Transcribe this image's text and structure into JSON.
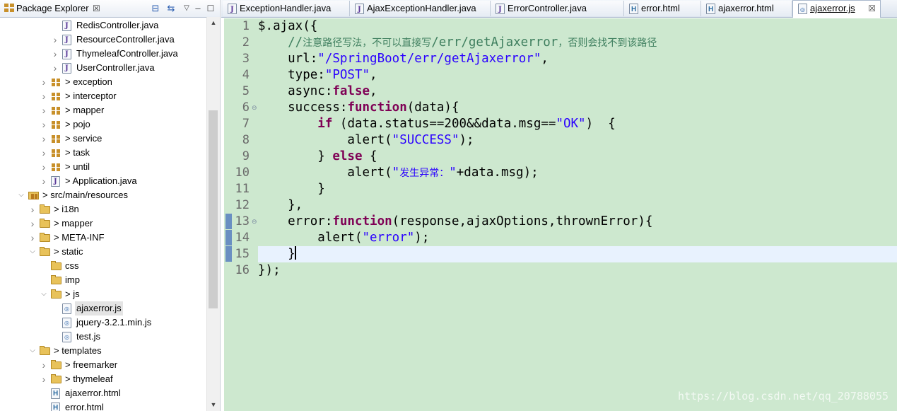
{
  "explorer": {
    "title": "Package Explorer",
    "close": "☒",
    "tree": [
      {
        "label": "RedisController.java",
        "icon": "java-file-icon",
        "depth": 5,
        "twisty": "none"
      },
      {
        "label": "ResourceController.java",
        "icon": "java-file-icon",
        "depth": 5,
        "twisty": "collapsed"
      },
      {
        "label": "ThymeleafController.java",
        "icon": "java-file-icon",
        "depth": 5,
        "twisty": "collapsed"
      },
      {
        "label": "UserController.java",
        "icon": "java-file-icon",
        "depth": 5,
        "twisty": "collapsed"
      },
      {
        "label": "> exception",
        "icon": "package-icon",
        "depth": 4,
        "twisty": "collapsed"
      },
      {
        "label": "> interceptor",
        "icon": "package-icon",
        "depth": 4,
        "twisty": "collapsed"
      },
      {
        "label": "> mapper",
        "icon": "package-icon",
        "depth": 4,
        "twisty": "collapsed"
      },
      {
        "label": "> pojo",
        "icon": "package-icon",
        "depth": 4,
        "twisty": "collapsed"
      },
      {
        "label": "> service",
        "icon": "package-icon",
        "depth": 4,
        "twisty": "collapsed"
      },
      {
        "label": "> task",
        "icon": "package-icon",
        "depth": 4,
        "twisty": "collapsed"
      },
      {
        "label": "> until",
        "icon": "package-icon",
        "depth": 4,
        "twisty": "collapsed"
      },
      {
        "label": "> Application.java",
        "icon": "java-file-icon",
        "depth": 4,
        "twisty": "collapsed"
      },
      {
        "label": "> src/main/resources",
        "icon": "source-folder-icon",
        "depth": 2,
        "twisty": "expanded"
      },
      {
        "label": "> i18n",
        "icon": "folder-icon",
        "depth": 3,
        "twisty": "collapsed"
      },
      {
        "label": "> mapper",
        "icon": "folder-icon",
        "depth": 3,
        "twisty": "collapsed"
      },
      {
        "label": "> META-INF",
        "icon": "folder-icon",
        "depth": 3,
        "twisty": "collapsed"
      },
      {
        "label": "> static",
        "icon": "folder-icon",
        "depth": 3,
        "twisty": "expanded"
      },
      {
        "label": "css",
        "icon": "folder-icon",
        "depth": 4,
        "twisty": "none"
      },
      {
        "label": "imp",
        "icon": "folder-icon",
        "depth": 4,
        "twisty": "none"
      },
      {
        "label": "> js",
        "icon": "folder-icon",
        "depth": 4,
        "twisty": "expanded"
      },
      {
        "label": "ajaxerror.js",
        "icon": "js-file-icon",
        "depth": 5,
        "twisty": "none",
        "selected": true
      },
      {
        "label": "jquery-3.2.1.min.js",
        "icon": "js-file-icon",
        "depth": 5,
        "twisty": "none"
      },
      {
        "label": "test.js",
        "icon": "js-file-icon",
        "depth": 5,
        "twisty": "none"
      },
      {
        "label": "> templates",
        "icon": "folder-icon",
        "depth": 3,
        "twisty": "expanded"
      },
      {
        "label": "> freemarker",
        "icon": "folder-icon",
        "depth": 4,
        "twisty": "collapsed"
      },
      {
        "label": "> thymeleaf",
        "icon": "folder-icon",
        "depth": 4,
        "twisty": "collapsed"
      },
      {
        "label": "ajaxerror.html",
        "icon": "html-file-icon",
        "depth": 4,
        "twisty": "none"
      },
      {
        "label": "error.html",
        "icon": "html-file-icon",
        "depth": 4,
        "twisty": "none"
      }
    ]
  },
  "editor_tabs": [
    {
      "label": "ExceptionHandler.java",
      "icon": "java-file-icon",
      "active": false
    },
    {
      "label": "AjaxExceptionHandler.java",
      "icon": "java-file-icon",
      "active": false
    },
    {
      "label": "ErrorController.java",
      "icon": "java-file-icon",
      "active": false
    },
    {
      "label": "error.html",
      "icon": "html-file-icon",
      "active": false
    },
    {
      "label": "ajaxerror.html",
      "icon": "html-file-icon",
      "active": false
    },
    {
      "label": "ajaxerror.js",
      "icon": "js-file-icon",
      "active": true,
      "close": "☒"
    }
  ],
  "editor": {
    "current_line": 15,
    "lines": [
      {
        "n": "1",
        "fold": "",
        "segments": [
          {
            "t": "$.ajax({",
            "c": ""
          }
        ]
      },
      {
        "n": "2",
        "fold": "",
        "segments": [
          {
            "t": "    //",
            "c": "cmt"
          },
          {
            "t": "注意路径写法，不可以直接写",
            "c": "cmt cn"
          },
          {
            "t": "/err/getAjaxerror",
            "c": "cmt"
          },
          {
            "t": "，否则会找不到该路径",
            "c": "cmt cn"
          }
        ]
      },
      {
        "n": "3",
        "fold": "",
        "segments": [
          {
            "t": "    url:",
            "c": ""
          },
          {
            "t": "\"/SpringBoot/err/getAjaxerror\"",
            "c": "str"
          },
          {
            "t": ",",
            "c": ""
          }
        ]
      },
      {
        "n": "4",
        "fold": "",
        "segments": [
          {
            "t": "    type:",
            "c": ""
          },
          {
            "t": "\"POST\"",
            "c": "str"
          },
          {
            "t": ",",
            "c": ""
          }
        ]
      },
      {
        "n": "5",
        "fold": "",
        "segments": [
          {
            "t": "    async:",
            "c": ""
          },
          {
            "t": "false",
            "c": "kw"
          },
          {
            "t": ",",
            "c": ""
          }
        ]
      },
      {
        "n": "6",
        "fold": "⊖",
        "segments": [
          {
            "t": "    success:",
            "c": ""
          },
          {
            "t": "function",
            "c": "kw"
          },
          {
            "t": "(data){",
            "c": ""
          }
        ]
      },
      {
        "n": "7",
        "fold": "",
        "segments": [
          {
            "t": "        ",
            "c": ""
          },
          {
            "t": "if",
            "c": "kw"
          },
          {
            "t": " (data.status==200&&data.msg==",
            "c": ""
          },
          {
            "t": "\"OK\"",
            "c": "str"
          },
          {
            "t": ")  {",
            "c": ""
          }
        ]
      },
      {
        "n": "8",
        "fold": "",
        "segments": [
          {
            "t": "            alert(",
            "c": ""
          },
          {
            "t": "\"SUCCESS\"",
            "c": "str"
          },
          {
            "t": ");",
            "c": ""
          }
        ]
      },
      {
        "n": "9",
        "fold": "",
        "segments": [
          {
            "t": "        } ",
            "c": ""
          },
          {
            "t": "else",
            "c": "kw"
          },
          {
            "t": " {",
            "c": ""
          }
        ]
      },
      {
        "n": "10",
        "fold": "",
        "segments": [
          {
            "t": "            alert(",
            "c": ""
          },
          {
            "t": "\"",
            "c": "str"
          },
          {
            "t": "发生异常：",
            "c": "str cn"
          },
          {
            "t": "\"",
            "c": "str"
          },
          {
            "t": "+data.msg);",
            "c": ""
          }
        ]
      },
      {
        "n": "11",
        "fold": "",
        "segments": [
          {
            "t": "        }",
            "c": ""
          }
        ]
      },
      {
        "n": "12",
        "fold": "",
        "segments": [
          {
            "t": "    },",
            "c": ""
          }
        ]
      },
      {
        "n": "13",
        "fold": "⊖",
        "segments": [
          {
            "t": "    error:",
            "c": ""
          },
          {
            "t": "function",
            "c": "kw"
          },
          {
            "t": "(response,ajaxOptions,thrownError){",
            "c": ""
          }
        ]
      },
      {
        "n": "14",
        "fold": "",
        "segments": [
          {
            "t": "        alert(",
            "c": ""
          },
          {
            "t": "\"error\"",
            "c": "str"
          },
          {
            "t": ");",
            "c": ""
          }
        ]
      },
      {
        "n": "15",
        "fold": "",
        "segments": [
          {
            "t": "    }",
            "c": ""
          }
        ],
        "caret": true
      },
      {
        "n": "16",
        "fold": "",
        "segments": [
          {
            "t": "});",
            "c": ""
          }
        ]
      }
    ],
    "annotation_lines": [
      13,
      14,
      15
    ]
  },
  "watermark": "https://blog.csdn.net/qq_20788055",
  "colors": {
    "editor_bg": "#cde8cf",
    "current_line_bg": "#e8f2fe",
    "keyword": "#7f0055",
    "string": "#2a00ff",
    "comment": "#3f7f5f"
  }
}
